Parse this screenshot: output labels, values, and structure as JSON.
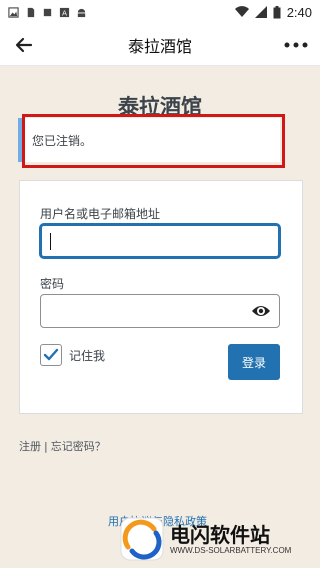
{
  "status_bar": {
    "time": "2:40",
    "icons": [
      "image-icon",
      "sim-icon",
      "square-icon",
      "font-icon",
      "android-icon",
      "wifi-icon",
      "signal-icon",
      "battery-icon"
    ]
  },
  "app_bar": {
    "title": "泰拉酒馆",
    "back_icon": "arrow-left-icon",
    "more_icon": "more-dots-icon"
  },
  "page": {
    "site_title": "泰拉酒馆",
    "notice": "您已注销。",
    "form": {
      "username_label": "用户名或电子邮箱地址",
      "username_value": "",
      "password_label": "密码",
      "password_value": "",
      "remember_label": "记住我",
      "remember_checked": true,
      "login_label": "登录"
    },
    "links": {
      "register": "注册",
      "separator": "|",
      "forgot": "忘记密码？"
    },
    "privacy": "用户协议与隐私政策"
  },
  "watermark": {
    "title": "电闪软件站",
    "subtitle": "WWW.DS-SOLARBATTERY.COM"
  },
  "colors": {
    "accent": "#2271b1",
    "highlight": "#d01818",
    "background": "#f2ece3"
  }
}
